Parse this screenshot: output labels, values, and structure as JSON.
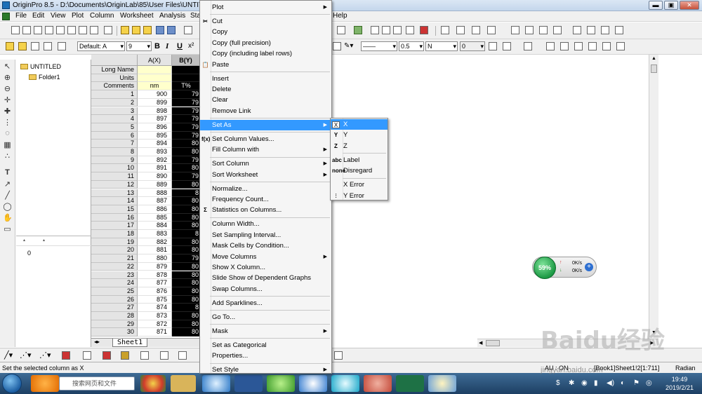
{
  "window": {
    "title": "OriginPro 8.5 - D:\\Documents\\OriginLab\\85\\User Files\\UNTITLE",
    "controls": [
      "▬",
      "▣",
      "✕"
    ]
  },
  "menubar": [
    "File",
    "Edit",
    "View",
    "Plot",
    "Column",
    "Worksheet",
    "Analysis",
    "Sta",
    "Help"
  ],
  "toolbar": {
    "font_name": "Default: A",
    "font_size": "9",
    "bold": "B",
    "italic": "I",
    "underline": "U",
    "line_width": "0.5",
    "pattern": "N",
    "number": "0"
  },
  "explorer": {
    "root": "UNTITLED",
    "folder": "Folder1",
    "list_value": "0"
  },
  "sheet": {
    "col_a_header": "A(X)",
    "col_b_header": "B(Y)",
    "meta_rows": [
      {
        "label": "Long Name",
        "a": "",
        "b": ""
      },
      {
        "label": "Units",
        "a": "",
        "b": ""
      },
      {
        "label": "Comments",
        "a": "nm",
        "b": "T%"
      }
    ],
    "rows": [
      {
        "n": "1",
        "a": "900",
        "b": "79"
      },
      {
        "n": "2",
        "a": "899",
        "b": "79"
      },
      {
        "n": "3",
        "a": "898",
        "b": "79"
      },
      {
        "n": "4",
        "a": "897",
        "b": "79"
      },
      {
        "n": "5",
        "a": "896",
        "b": "79"
      },
      {
        "n": "6",
        "a": "895",
        "b": "79"
      },
      {
        "n": "7",
        "a": "894",
        "b": "80"
      },
      {
        "n": "8",
        "a": "893",
        "b": "80"
      },
      {
        "n": "9",
        "a": "892",
        "b": "79"
      },
      {
        "n": "10",
        "a": "891",
        "b": "80"
      },
      {
        "n": "11",
        "a": "890",
        "b": "79"
      },
      {
        "n": "12",
        "a": "889",
        "b": "80"
      },
      {
        "n": "13",
        "a": "888",
        "b": "8"
      },
      {
        "n": "14",
        "a": "887",
        "b": "80"
      },
      {
        "n": "15",
        "a": "886",
        "b": "80"
      },
      {
        "n": "16",
        "a": "885",
        "b": "80"
      },
      {
        "n": "17",
        "a": "884",
        "b": "80"
      },
      {
        "n": "18",
        "a": "883",
        "b": "8"
      },
      {
        "n": "19",
        "a": "882",
        "b": "80"
      },
      {
        "n": "20",
        "a": "881",
        "b": "80"
      },
      {
        "n": "21",
        "a": "880",
        "b": "79"
      },
      {
        "n": "22",
        "a": "879",
        "b": "80"
      },
      {
        "n": "23",
        "a": "878",
        "b": "80"
      },
      {
        "n": "24",
        "a": "877",
        "b": "80"
      },
      {
        "n": "25",
        "a": "876",
        "b": "80"
      },
      {
        "n": "26",
        "a": "875",
        "b": "80"
      },
      {
        "n": "27",
        "a": "874",
        "b": "8"
      },
      {
        "n": "28",
        "a": "873",
        "b": "80"
      },
      {
        "n": "29",
        "a": "872",
        "b": "80"
      },
      {
        "n": "30",
        "a": "871",
        "b": "80"
      }
    ],
    "tab": "Sheet1"
  },
  "context_menu": {
    "items": [
      {
        "label": "Plot",
        "submenu": true
      },
      {
        "sep": true
      },
      {
        "label": "Cut",
        "icon": "✂"
      },
      {
        "label": "Copy"
      },
      {
        "label": "Copy (full precision)"
      },
      {
        "label": "Copy (including label rows)"
      },
      {
        "label": "Paste",
        "icon": "📋"
      },
      {
        "sep": true
      },
      {
        "label": "Insert"
      },
      {
        "label": "Delete"
      },
      {
        "label": "Clear"
      },
      {
        "label": "Remove Link"
      },
      {
        "sep": true
      },
      {
        "label": "Set As",
        "submenu": true,
        "highlight": true
      },
      {
        "sep": true
      },
      {
        "label": "Set Column Values...",
        "icon": "f(x)"
      },
      {
        "label": "Fill Column with",
        "submenu": true
      },
      {
        "sep": true
      },
      {
        "label": "Sort Column",
        "submenu": true
      },
      {
        "label": "Sort Worksheet",
        "submenu": true
      },
      {
        "sep": true
      },
      {
        "label": "Normalize..."
      },
      {
        "label": "Frequency Count..."
      },
      {
        "label": "Statistics on Columns...",
        "icon": "Σ"
      },
      {
        "sep": true
      },
      {
        "label": "Column Width..."
      },
      {
        "label": "Set Sampling Interval..."
      },
      {
        "label": "Mask Cells by Condition..."
      },
      {
        "label": "Move Columns",
        "submenu": true
      },
      {
        "label": "Show X Column..."
      },
      {
        "label": "Slide Show of Dependent Graphs"
      },
      {
        "label": "Swap Columns..."
      },
      {
        "sep": true
      },
      {
        "label": "Add Sparklines..."
      },
      {
        "sep": true
      },
      {
        "label": "Go To..."
      },
      {
        "sep": true
      },
      {
        "label": "Mask",
        "submenu": true
      },
      {
        "sep": true
      },
      {
        "label": "Set as Categorical"
      },
      {
        "label": "Properties..."
      },
      {
        "sep": true
      },
      {
        "label": "Set Style",
        "submenu": true
      }
    ]
  },
  "submenu_set_as": {
    "items": [
      {
        "label": "X",
        "icon": "X",
        "highlight": true
      },
      {
        "label": "Y",
        "icon": "Y"
      },
      {
        "label": "Z",
        "icon": "Z"
      },
      {
        "sep": true
      },
      {
        "label": "Label",
        "icon": "abc"
      },
      {
        "label": "Disregard",
        "icon": "none"
      },
      {
        "sep": true
      },
      {
        "label": "X Error",
        "icon": ""
      },
      {
        "label": "Y Error",
        "icon": "⫶"
      }
    ]
  },
  "statusbar": {
    "message": "Set the selected column as X",
    "au": "AU : ON",
    "book": "[Book1]Sheet1!2[1:711]",
    "angle": "Radian"
  },
  "netwidget": {
    "percent": "59%",
    "up": "0K/s",
    "down": "0K/s"
  },
  "taskbar": {
    "search_placeholder": "搜索网页和文件",
    "time": "19:49",
    "date": "2019/2/21"
  },
  "watermark": {
    "brand": "Baidu经验",
    "url": "jingyan.baidu.com"
  },
  "colors": {
    "menu_highlight": "#3399ff",
    "selected_column": "#000000",
    "header_yellow": "#ffffcc"
  }
}
